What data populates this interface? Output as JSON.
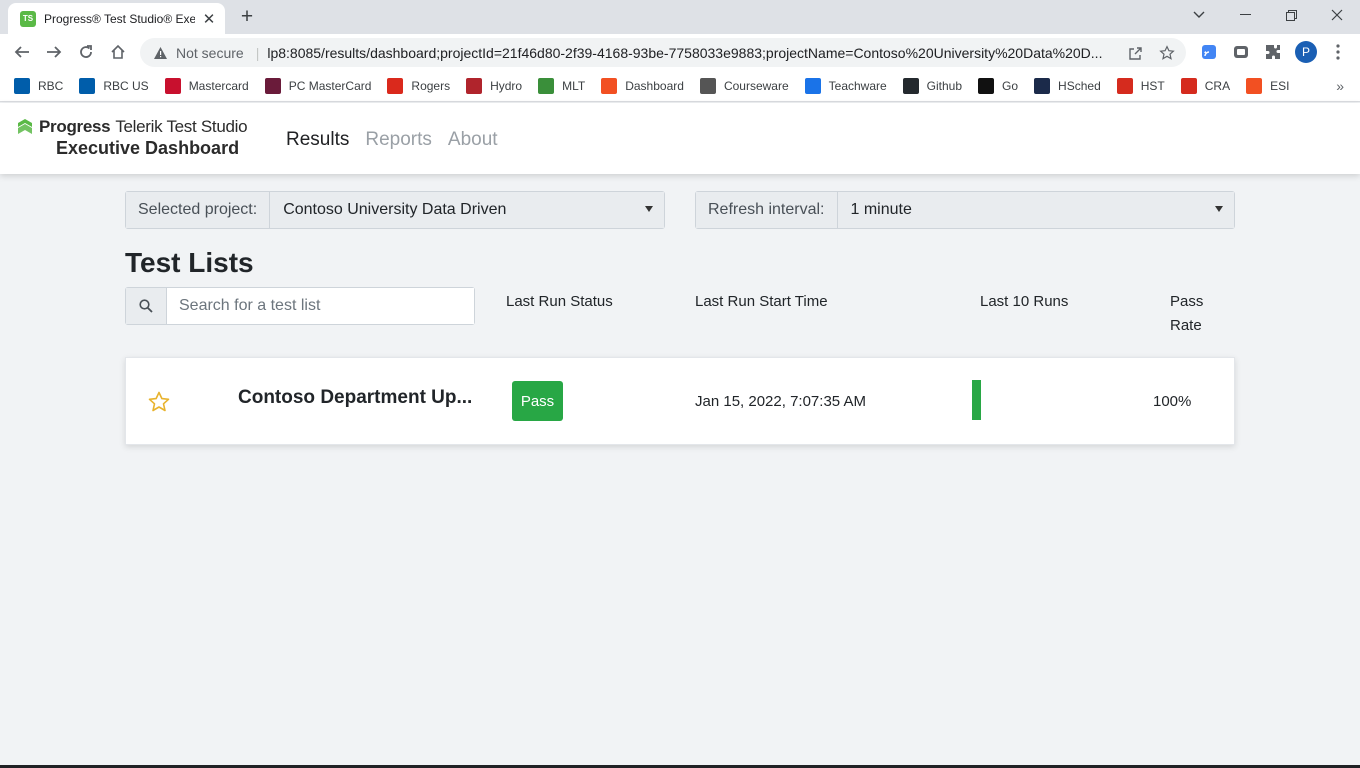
{
  "browser": {
    "tab_title": "Progress® Test Studio® Executive Dashboard",
    "tab_favicon_text": "TS",
    "not_secure_label": "Not secure",
    "url": "lp8:8085/results/dashboard;projectId=21f46d80-2f39-4168-93be-7758033e9883;projectName=Contoso%20University%20Data%20D...",
    "profile_initial": "P",
    "bookmarks": [
      {
        "label": "RBC",
        "icon": "rbc-icon",
        "color": "#005daa"
      },
      {
        "label": "RBC US",
        "icon": "rbc-icon",
        "color": "#005daa"
      },
      {
        "label": "Mastercard",
        "icon": "mastercard-icon",
        "color": "#c8102e"
      },
      {
        "label": "PC MasterCard",
        "icon": "pc-icon",
        "color": "#6a1b3a"
      },
      {
        "label": "Rogers",
        "icon": "rogers-icon",
        "color": "#da291c"
      },
      {
        "label": "Hydro",
        "icon": "hydro-icon",
        "color": "#b0242c"
      },
      {
        "label": "MLT",
        "icon": "globe-icon",
        "color": "#3a8f3a"
      },
      {
        "label": "Dashboard",
        "icon": "microsoft-icon",
        "color": "#f25022"
      },
      {
        "label": "Courseware",
        "icon": "courseware-icon",
        "color": "#555555"
      },
      {
        "label": "Teachware",
        "icon": "teachware-icon",
        "color": "#1a73e8"
      },
      {
        "label": "Github",
        "icon": "github-icon",
        "color": "#24292e"
      },
      {
        "label": "Go",
        "icon": "go-icon",
        "color": "#111111"
      },
      {
        "label": "HSched",
        "icon": "hsched-icon",
        "color": "#1b2a4a"
      },
      {
        "label": "HST",
        "icon": "maple-leaf-icon",
        "color": "#d52b1e"
      },
      {
        "label": "CRA",
        "icon": "maple-leaf-icon",
        "color": "#d52b1e"
      },
      {
        "label": "ESI",
        "icon": "microsoft-icon",
        "color": "#f25022"
      }
    ]
  },
  "app": {
    "logo_progress": "Progress",
    "logo_product": "Telerik Test Studio",
    "logo_subtitle": "Executive Dashboard",
    "nav": [
      {
        "label": "Results",
        "active": true
      },
      {
        "label": "Reports",
        "active": false
      },
      {
        "label": "About",
        "active": false
      }
    ],
    "project_filter": {
      "label": "Selected project:",
      "value": "Contoso University Data Driven"
    },
    "refresh_filter": {
      "label": "Refresh interval:",
      "value": "1 minute"
    },
    "section_title": "Test Lists",
    "search_placeholder": "Search for a test list",
    "columns": {
      "last_run_status": "Last Run Status",
      "last_run_start": "Last Run Start Time",
      "last_10_runs": "Last 10 Runs",
      "pass_rate": "Pass Rate"
    },
    "rows": [
      {
        "name": "Contoso Department Up...",
        "status": "Pass",
        "start_time": "Jan 15, 2022, 7:07:35 AM",
        "last_runs": [
          1.0
        ],
        "pass_rate": "100%",
        "favorite": false
      }
    ]
  },
  "colors": {
    "pass": "#28a745",
    "star": "#e8b32e",
    "brand_green": "#5ab946"
  }
}
